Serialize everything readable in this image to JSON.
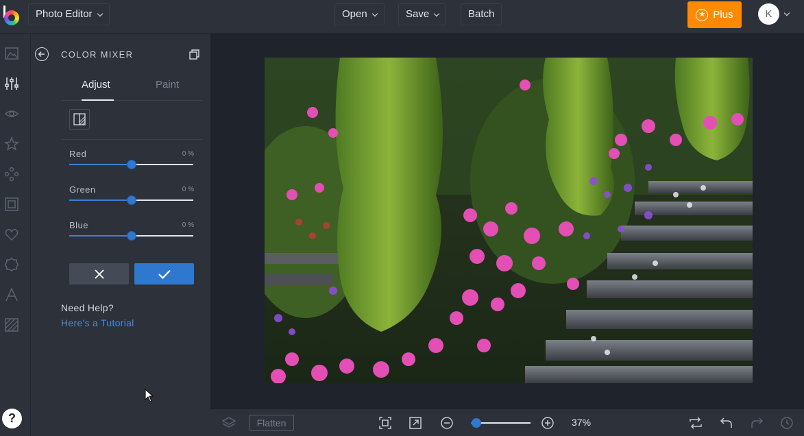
{
  "topbar": {
    "app_menu": "Photo Editor",
    "open_label": "Open",
    "save_label": "Save",
    "batch_label": "Batch",
    "plus_label": "Plus",
    "avatar_initial": "K"
  },
  "rail": {
    "icons": [
      "image-icon",
      "sliders-icon",
      "eye-icon",
      "star-icon",
      "nodes-icon",
      "frame-icon",
      "heart-icon",
      "badge-icon",
      "text-icon",
      "texture-icon"
    ],
    "help_label": "?"
  },
  "panel": {
    "title": "COLOR MIXER",
    "tabs": [
      {
        "label": "Adjust",
        "active": true
      },
      {
        "label": "Paint",
        "active": false
      }
    ],
    "sliders": [
      {
        "label": "Red",
        "value": "0 %",
        "level": 0.5
      },
      {
        "label": "Green",
        "value": "0 %",
        "level": 0.5
      },
      {
        "label": "Blue",
        "value": "0 %",
        "level": 0.5
      }
    ],
    "help_title": "Need Help?",
    "help_link": "Here's a Tutorial"
  },
  "bottombar": {
    "flatten_label": "Flatten",
    "zoom_value": "37%",
    "zoom_level": 0.09
  },
  "colors": {
    "accent": "#2f78d0",
    "plus": "#ff8a00",
    "panel_bg": "#2c313a",
    "canvas_bg": "#1f232b"
  }
}
